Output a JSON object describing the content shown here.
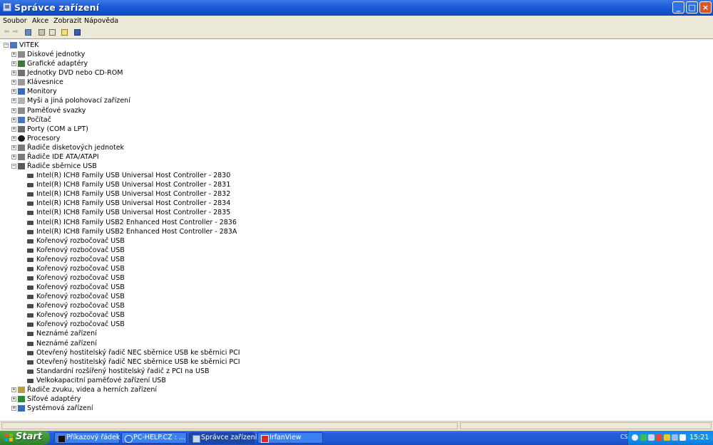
{
  "window": {
    "title": "Správce zařízení",
    "buttons": {
      "minimize": "_",
      "maximize": "□",
      "close": "×"
    }
  },
  "menu": [
    "Soubor",
    "Akce",
    "Zobrazit",
    "Nápověda"
  ],
  "toolbar": {
    "back": "⇦",
    "forward": "⇨"
  },
  "tree": {
    "root": "VITEK",
    "categories": [
      "Diskové jednotky",
      "Grafické adaptéry",
      "Jednotky DVD nebo CD-ROM",
      "Klávesnice",
      "Monitory",
      "Myši a jiná polohovací zařízení",
      "Paměťové svazky",
      "Počítač",
      "Porty (COM a LPT)",
      "Procesory",
      "Řadiče disketových jednotek",
      "Řadiče IDE ATA/ATAPI",
      "Řadiče sběrnice USB"
    ],
    "usb_children": [
      "Intel(R) ICH8 Family USB Universal Host Controller - 2830",
      "Intel(R) ICH8 Family USB Universal Host Controller - 2831",
      "Intel(R) ICH8 Family USB Universal Host Controller - 2832",
      "Intel(R) ICH8 Family USB Universal Host Controller - 2834",
      "Intel(R) ICH8 Family USB Universal Host Controller - 2835",
      "Intel(R) ICH8 Family USB2 Enhanced Host Controller - 2836",
      "Intel(R) ICH8 Family USB2 Enhanced Host Controller - 283A",
      "Kořenový rozbočovač USB",
      "Kořenový rozbočovač USB",
      "Kořenový rozbočovač USB",
      "Kořenový rozbočovač USB",
      "Kořenový rozbočovač USB",
      "Kořenový rozbočovač USB",
      "Kořenový rozbočovač USB",
      "Kořenový rozbočovač USB",
      "Kořenový rozbočovač USB",
      "Kořenový rozbočovač USB",
      "Neznámé zařízení",
      "Neznámé zařízení",
      "Otevřený hostitelský řadič NEC sběrnice USB ke sběrnici PCI",
      "Otevřený hostitelský řadič NEC sběrnice USB ke sběrnici PCI",
      "Standardní rozšířený hostitelský řadič z PCI na USB",
      "Velkokapacitní paměťové zařízení USB"
    ],
    "categories_after": [
      "Řadiče zvuku, videa a herních zařízení",
      "Síťové adaptéry",
      "Systémová zařízení"
    ]
  },
  "taskbar": {
    "start": "Start",
    "tasks": [
      "Příkazový řádek",
      "PC-HELP.CZ : ...",
      "Správce zařízení",
      "IrfanView"
    ],
    "active_task": "Správce zařízení",
    "language": "CS",
    "clock": "15:21"
  },
  "icons": {
    "category_icons": [
      "drive-icon",
      "display-adapter-icon",
      "dvd-drive-icon",
      "keyboard-icon",
      "monitor-icon",
      "mouse-icon",
      "storage-volume-icon",
      "computer-icon",
      "port-icon",
      "processor-icon",
      "floppy-controller-icon",
      "ide-controller-icon",
      "usb-controller-icon"
    ],
    "after_icons": [
      "sound-icon",
      "network-adapter-icon",
      "system-device-icon"
    ]
  },
  "colors": {
    "titlebar": "#1c5ad8",
    "taskbar": "#245edb",
    "start_button": "#3a9133",
    "tray": "#1397ef",
    "chrome": "#ece9d8"
  }
}
